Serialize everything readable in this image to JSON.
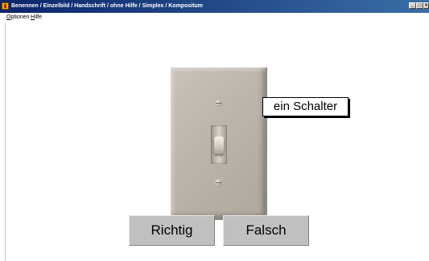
{
  "window": {
    "title": "Benennen / Einzelbild / Handschrift / ohne Hilfe / Simplex / Kompositum",
    "controls": {
      "minimize": "_",
      "maximize": "□",
      "close": "×"
    }
  },
  "menu": {
    "items": [
      {
        "mnemonic": "O",
        "rest": "ptionen"
      },
      {
        "mnemonic": "H",
        "rest": "ilfe"
      }
    ]
  },
  "content": {
    "picture_icon": "light-switch-picture",
    "label": "ein Schalter",
    "buttons": {
      "correct": "Richtig",
      "wrong": "Falsch"
    }
  }
}
